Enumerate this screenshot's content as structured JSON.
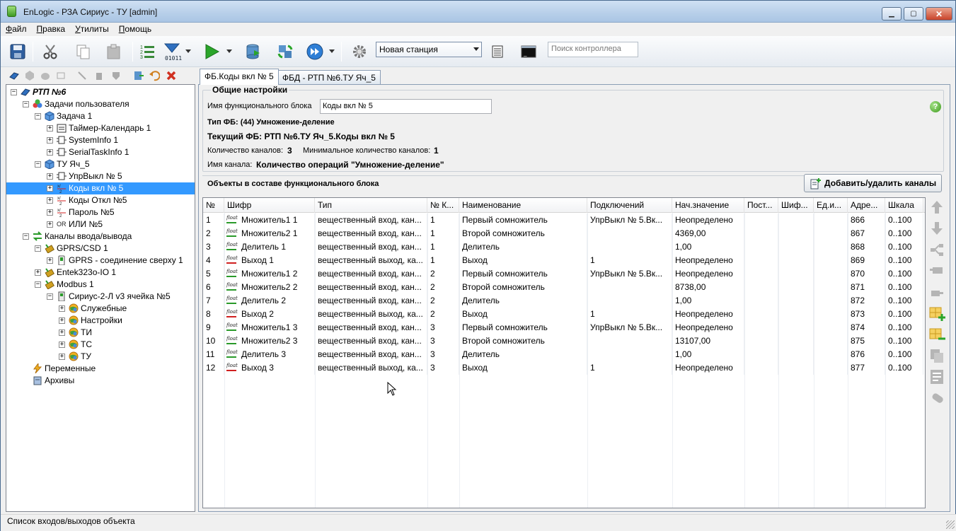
{
  "window": {
    "title": "EnLogic - РЗА Сириус - ТУ [admin]"
  },
  "menu": [
    {
      "label": "Файл",
      "ul": "Ф",
      "rest": "айл"
    },
    {
      "label": "Правка",
      "ul": "П",
      "rest": "равка"
    },
    {
      "label": "Утилиты",
      "ul": "У",
      "rest": "тилиты"
    },
    {
      "label": "Помощь",
      "ul": "П",
      "rest": "омощь"
    }
  ],
  "toolbar": {
    "station_combo": "Новая станция",
    "search_placeholder": "Поиск контроллера"
  },
  "tree": [
    {
      "label": "РТП №6",
      "bold": true,
      "icon": "project-icon"
    },
    {
      "label": "Задачи пользователя",
      "icon": "tasks-icon"
    },
    {
      "label": "Задача 1",
      "icon": "cube-icon"
    },
    {
      "label": "Таймер-Календарь 1",
      "icon": "calendar-icon"
    },
    {
      "label": "SystemInfo 1",
      "icon": "fb-icon"
    },
    {
      "label": "SerialTaskInfo 1",
      "icon": "fb-icon"
    },
    {
      "label": "ТУ Яч_5",
      "icon": "cube-icon"
    },
    {
      "label": "УпрВыкл  № 5",
      "icon": "fb-icon"
    },
    {
      "label": "Коды вкл № 5",
      "icon": "muldiv-icon"
    },
    {
      "label": "Коды Откл №5",
      "icon": "muldiv-icon"
    },
    {
      "label": "Пароль №5",
      "icon": "muldiv-icon"
    },
    {
      "label": "ИЛИ №5",
      "icon": "or-icon",
      "or": "OR"
    },
    {
      "label": "Каналы ввода/вывода",
      "icon": "io-channels-icon"
    },
    {
      "label": "GPRS/CSD 1",
      "icon": "modem-icon"
    },
    {
      "label": "GPRS - соединение сверху 1",
      "icon": "gprs-icon"
    },
    {
      "label": "Entek323o-IO 1",
      "icon": "modem-icon"
    },
    {
      "label": "Modbus 1",
      "icon": "modem-icon"
    },
    {
      "label": "Сириус-2-Л v3  ячейка №5",
      "icon": "device-icon"
    },
    {
      "label": "Служебные",
      "icon": "globe-icon"
    },
    {
      "label": "Настройки",
      "icon": "globe-icon"
    },
    {
      "label": "ТИ",
      "icon": "globe-icon"
    },
    {
      "label": "ТС",
      "icon": "globe-icon"
    },
    {
      "label": "ТУ",
      "icon": "globe-icon"
    },
    {
      "label": "Переменные",
      "icon": "lightning-icon"
    },
    {
      "label": "Архивы",
      "icon": "archive-icon"
    }
  ],
  "tabs": [
    {
      "label": "ФБ.Коды вкл № 5",
      "active": true
    },
    {
      "label": "ФБД -  РТП №6.ТУ Яч_5",
      "active": false
    }
  ],
  "settings": {
    "group_title": "Общие настройки",
    "fb_name_label": "Имя функционального блока",
    "fb_name_value": "Коды вкл № 5",
    "fb_type": "Тип ФБ: (44) Умножение-деление",
    "current_fb": "Текущий ФБ:  РТП №6.ТУ Яч_5.Коды вкл № 5",
    "channels_label": "Количество каналов:",
    "channels_value": "3",
    "min_channels_label": "Минимальное количество каналов:",
    "min_channels_value": "1",
    "channel_name_label": "Имя канала:",
    "channel_name_value": "Количество операций \"Умножение-деление\""
  },
  "objects": {
    "title": "Объекты в составе функционального блока",
    "add_button": "Добавить/удалить каналы",
    "columns": [
      "№",
      "Шифр",
      "Тип",
      "№ К...",
      "Наименование",
      "Подключений",
      "Нач.значение",
      "Пост...",
      "Шиф...",
      "Ед.и...",
      "Адре...",
      "Шкала"
    ],
    "float_label": "float",
    "rows": [
      [
        "1",
        "Множитель1 1",
        "вещественный вход, кан...",
        "1",
        "Первый сомножитель",
        "УпрВыкл  № 5.Вк...",
        "Неопределено",
        "",
        "",
        "",
        "866",
        "0..100",
        "in"
      ],
      [
        "2",
        "Множитель2 1",
        "вещественный вход, кан...",
        "1",
        "Второй сомножитель",
        "",
        "4369,00",
        "",
        "",
        "",
        "867",
        "0..100",
        "in"
      ],
      [
        "3",
        "Делитель 1",
        "вещественный вход, кан...",
        "1",
        "Делитель",
        "",
        "1,00",
        "",
        "",
        "",
        "868",
        "0..100",
        "in"
      ],
      [
        "4",
        "Выход 1",
        "вещественный выход, ка...",
        "1",
        "Выход",
        "1",
        "Неопределено",
        "",
        "",
        "",
        "869",
        "0..100",
        "out"
      ],
      [
        "5",
        "Множитель1 2",
        "вещественный вход, кан...",
        "2",
        "Первый сомножитель",
        "УпрВыкл  № 5.Вк...",
        "Неопределено",
        "",
        "",
        "",
        "870",
        "0..100",
        "in"
      ],
      [
        "6",
        "Множитель2 2",
        "вещественный вход, кан...",
        "2",
        "Второй сомножитель",
        "",
        "8738,00",
        "",
        "",
        "",
        "871",
        "0..100",
        "in"
      ],
      [
        "7",
        "Делитель 2",
        "вещественный вход, кан...",
        "2",
        "Делитель",
        "",
        "1,00",
        "",
        "",
        "",
        "872",
        "0..100",
        "in"
      ],
      [
        "8",
        "Выход 2",
        "вещественный выход, ка...",
        "2",
        "Выход",
        "1",
        "Неопределено",
        "",
        "",
        "",
        "873",
        "0..100",
        "out"
      ],
      [
        "9",
        "Множитель1 3",
        "вещественный вход, кан...",
        "3",
        "Первый сомножитель",
        "УпрВыкл  № 5.Вк...",
        "Неопределено",
        "",
        "",
        "",
        "874",
        "0..100",
        "in"
      ],
      [
        "10",
        "Множитель2 3",
        "вещественный вход, кан...",
        "3",
        "Второй сомножитель",
        "",
        "13107,00",
        "",
        "",
        "",
        "875",
        "0..100",
        "in"
      ],
      [
        "11",
        "Делитель 3",
        "вещественный вход, кан...",
        "3",
        "Делитель",
        "",
        "1,00",
        "",
        "",
        "",
        "876",
        "0..100",
        "in"
      ],
      [
        "12",
        "Выход 3",
        "вещественный выход, ка...",
        "3",
        "Выход",
        "1",
        "Неопределено",
        "",
        "",
        "",
        "877",
        "0..100",
        "out"
      ]
    ]
  },
  "status": {
    "text": "Список входов/выходов объекта"
  },
  "colors": {
    "selection": "#3399ff",
    "accent": "#2a9a2a"
  }
}
